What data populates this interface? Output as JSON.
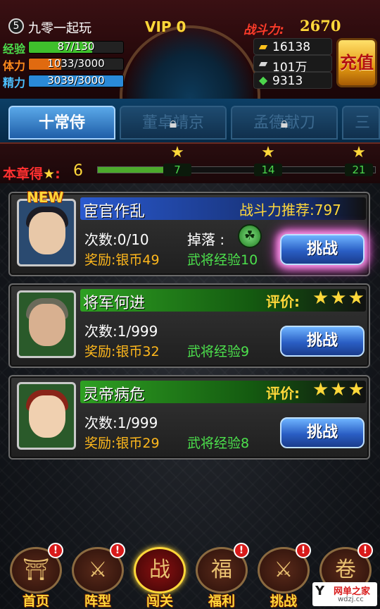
{
  "header": {
    "level": "5",
    "player_name": "九零一起玩",
    "vip": "VIP 0",
    "power_label": "战斗力:",
    "power_value": "2670",
    "stats": [
      {
        "label": "经验",
        "value": "87/130",
        "ratio": 0.67,
        "color": "#3fbf2c",
        "label_color": "#4ce04c"
      },
      {
        "label": "体力",
        "value": "1033/3000",
        "ratio": 0.34,
        "color": "#e06a10",
        "label_color": "#ff8a1c"
      },
      {
        "label": "精力",
        "value": "3039/3000",
        "ratio": 1.0,
        "color": "#2a8ad8",
        "label_color": "#4cc0ff"
      }
    ],
    "resources": [
      {
        "icon": "gold-ingot-icon",
        "value": "16138"
      },
      {
        "icon": "silver-ingot-icon",
        "value": "101万"
      },
      {
        "icon": "jade-icon",
        "value": "9313"
      }
    ],
    "recharge_label": "充值"
  },
  "tabs": [
    {
      "label": "十常侍",
      "active": true,
      "locked": false
    },
    {
      "label": "董卓靖京",
      "active": false,
      "locked": true
    },
    {
      "label": "孟德献刀",
      "active": false,
      "locked": true
    },
    {
      "label": "三英",
      "active": false,
      "locked": true
    }
  ],
  "chapter": {
    "label": "本章得",
    "stars": "6",
    "progress_ratio": 0.28,
    "milestones": [
      "7",
      "14",
      "21"
    ]
  },
  "levels": [
    {
      "title": "宦官作乱",
      "is_new": true,
      "new_label": "NEW",
      "power_rec": "战斗力推荐:797",
      "attempts": "次数:0/10",
      "drop_label": "掉落 :",
      "reward": "奖励:银币49",
      "exp": "武将经验10",
      "button": "挑战",
      "band_color": "#1f4fb0"
    },
    {
      "title": "将军何进",
      "rating_label": "评价:",
      "stars": "★★★",
      "attempts": "次数:1/999",
      "reward": "奖励:银币32",
      "exp": "武将经验9",
      "button": "挑战",
      "band_color": "#2a8a20"
    },
    {
      "title": "灵帝病危",
      "rating_label": "评价:",
      "stars": "★★★",
      "attempts": "次数:1/999",
      "reward": "奖励:银币29",
      "exp": "武将经验8",
      "button": "挑战",
      "band_color": "#2a8a20"
    }
  ],
  "nav": [
    {
      "label": "首页",
      "icon": "palace-icon",
      "glyph": "⛩",
      "alert": true
    },
    {
      "label": "阵型",
      "icon": "soldier-icon",
      "glyph": "⚔",
      "alert": true
    },
    {
      "label": "闯关",
      "icon": "war-flag-icon",
      "glyph": "战",
      "alert": false,
      "active": true
    },
    {
      "label": "福利",
      "icon": "fortune-bag-icon",
      "glyph": "福",
      "alert": true
    },
    {
      "label": "挑战",
      "icon": "sword-icon",
      "glyph": "⚔",
      "alert": true
    },
    {
      "label": "",
      "icon": "scroll-icon",
      "glyph": "卷",
      "alert": true
    }
  ],
  "watermark": {
    "logo": "Y",
    "text": "网单之家",
    "sub": "wdzj.cc"
  }
}
